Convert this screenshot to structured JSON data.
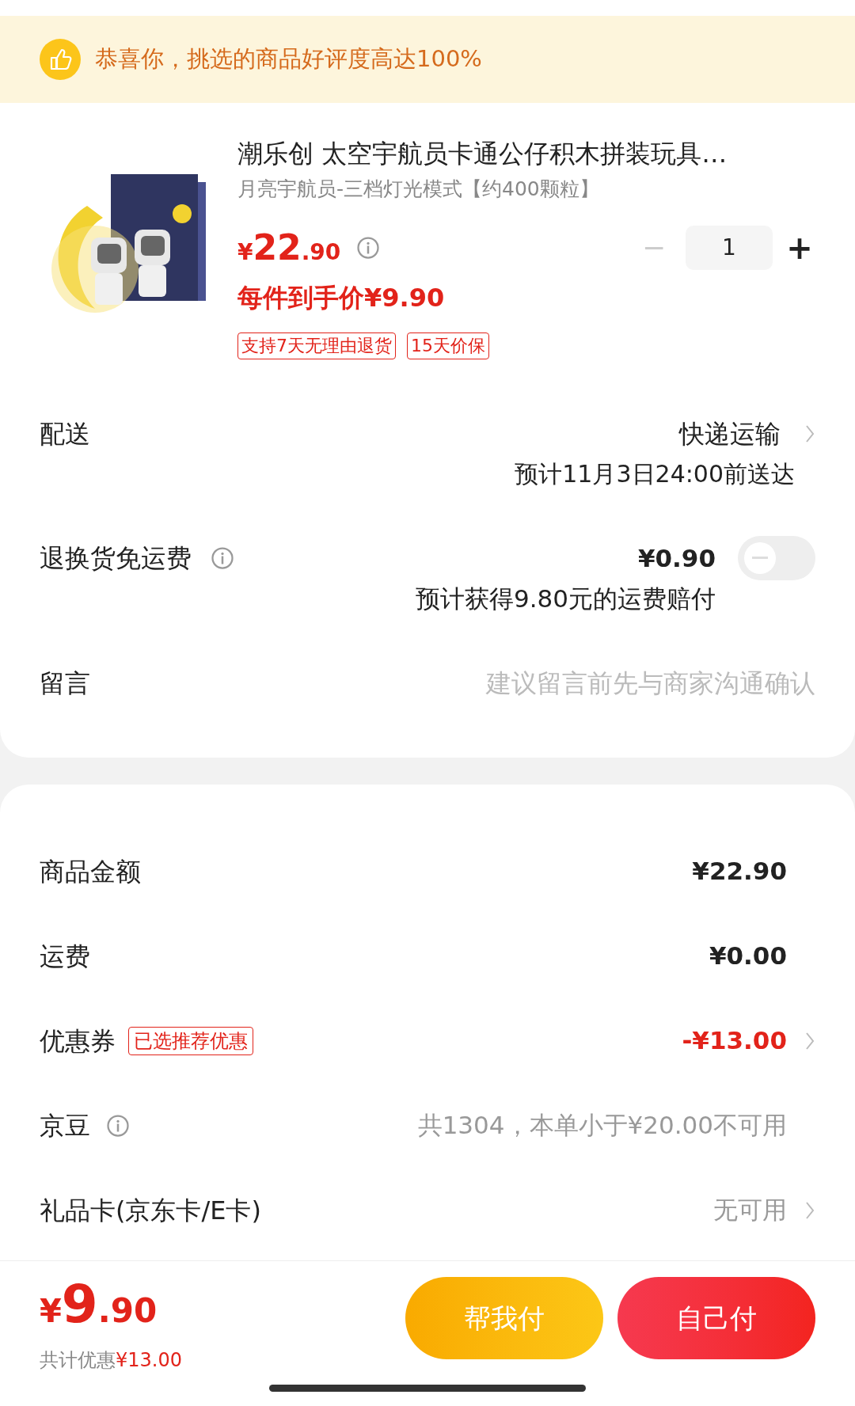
{
  "banner": {
    "text": "恭喜你，挑选的商品好评度高达100%"
  },
  "product": {
    "title": "潮乐创 太空宇航员卡通公仔积木拼装玩具…",
    "variant": "月亮宇航员-三档灯光模式【约400颗粒】",
    "price_symbol": "¥",
    "price_int": "22",
    "price_dec": ".90",
    "final_price": "每件到手价¥9.90",
    "quantity": "1",
    "minus": "−",
    "plus": "+",
    "tags": [
      "支持7天无理由退货",
      "15天价保"
    ]
  },
  "delivery": {
    "label": "配送",
    "method": "快递运输",
    "eta": "预计11月3日24:00前送达"
  },
  "return_insurance": {
    "label": "退换货免运费",
    "price": "¥0.90",
    "note": "预计获得9.80元的运费赔付",
    "on": false
  },
  "message": {
    "label": "留言",
    "placeholder": "建议留言前先与商家沟通确认"
  },
  "summary": [
    {
      "label": "商品金额",
      "value": "¥22.90",
      "kind": "plain"
    },
    {
      "label": "运费",
      "value": "¥0.00",
      "kind": "plain"
    },
    {
      "label": "优惠券",
      "badge": "已选推荐优惠",
      "value": "-¥13.00",
      "kind": "discount"
    },
    {
      "label": "京豆",
      "value": "共1304，本单小于¥20.00不可用",
      "kind": "info"
    },
    {
      "label": "礼品卡(京东卡/E卡)",
      "value": "无可用",
      "kind": "muted"
    }
  ],
  "footer": {
    "symbol": "¥",
    "int": "9",
    "dec": ".90",
    "saving_label": "共计优惠",
    "saving": "¥13.00",
    "buttons": [
      {
        "label": "帮我付",
        "kind": "secondary"
      },
      {
        "label": "自己付",
        "kind": "primary"
      }
    ]
  }
}
